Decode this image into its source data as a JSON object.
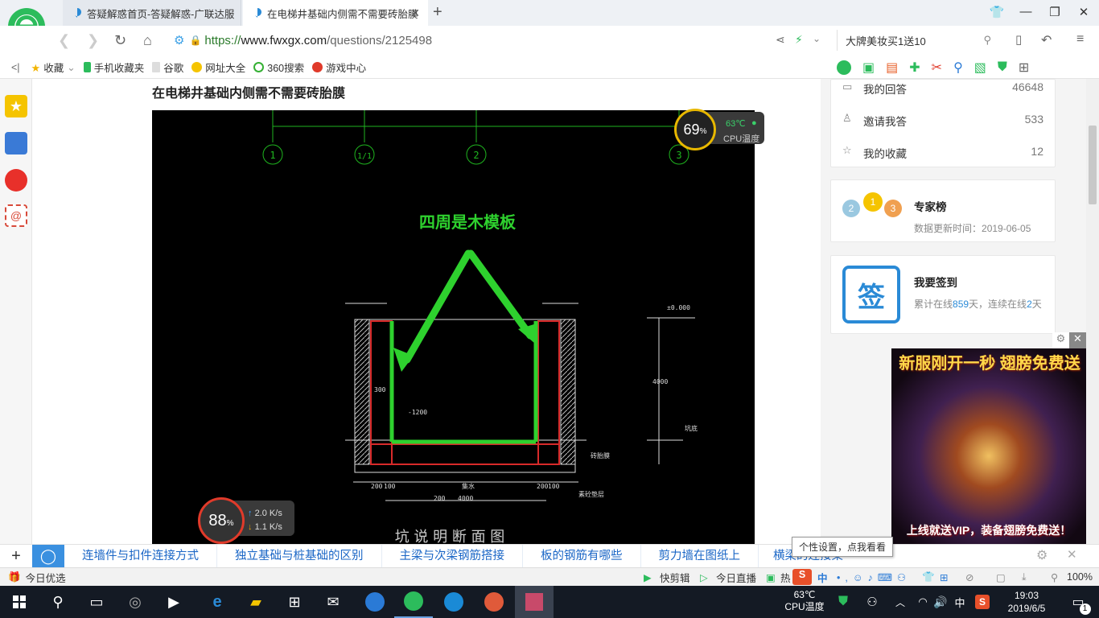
{
  "browser": {
    "tabs": [
      {
        "title": "答疑解惑首页-答疑解惑-广联达服"
      },
      {
        "title": "在电梯井基础内侧需不需要砖胎膜"
      }
    ],
    "url_https": "https://",
    "url_host": "www.fwxgx.com",
    "url_path": "/questions/2125498",
    "search_text": "大牌美妆买1送10"
  },
  "bookmarks": [
    "收藏",
    "手机收藏夹",
    "谷歌",
    "网址大全",
    "360搜索",
    "游戏中心"
  ],
  "page": {
    "title": "在电梯井基础内侧需不需要砖胎膜"
  },
  "cad": {
    "axes": [
      "1",
      "1/1",
      "2",
      "3"
    ],
    "annotation": "四周是木模板",
    "labels": [
      "300",
      "-1200",
      "±0.000",
      "砖胎膜",
      "素砼垫层",
      "4000",
      "200",
      "100",
      "集水",
      "200",
      "100",
      "200",
      "4000",
      "坑底"
    ],
    "bottom_text": "坑 说 明   断 面 图"
  },
  "cpu_widget": {
    "percent": "69",
    "unit": "%",
    "temp": "63℃",
    "label": "CPU温度"
  },
  "net_widget": {
    "percent": "88",
    "unit": "%",
    "up": "2.0",
    "down": "1.1",
    "rate_unit": "K/s"
  },
  "sidebar_right": {
    "stats": [
      {
        "label": "我的回答",
        "value": "46648"
      },
      {
        "label": "邀请我答",
        "value": "533"
      },
      {
        "label": "我的收藏",
        "value": "12"
      }
    ],
    "experts": {
      "title": "专家榜",
      "update_label": "数据更新时间：",
      "update_date": "2019-06-05",
      "medals": [
        "2",
        "1",
        "3"
      ]
    },
    "signin": {
      "title": "我要签到",
      "icon_text": "签",
      "prefix": "累计在线",
      "days1": "859",
      "mid": "天，连续在线",
      "days2": "2",
      "suffix": "天"
    }
  },
  "ad": {
    "top_text": "新服刚开一秒 翅膀免费送",
    "bottom_text": "上线就送VIP，装备翅膀免费送！"
  },
  "tooltip": "个性设置，点我看看",
  "related": [
    "连墙件与扣件连接方式",
    "独立基础与桩基础的区别",
    "主梁与次梁钢筋搭接",
    "板的钢筋有哪些",
    "剪力墙在图纸上",
    "横梁的连接梁"
  ],
  "statusbar": {
    "left": "今日优选",
    "items": [
      "快剪辑",
      "今日直播",
      "热"
    ],
    "ime": "中",
    "zoom": "100%"
  },
  "taskbar": {
    "cpu_temp": "63℃",
    "cpu_label": "CPU温度",
    "ime": "中",
    "time": "19:03",
    "date": "2019/6/5",
    "notif_count": "1"
  },
  "colors": {
    "accent_green": "#2ed12e",
    "link_blue": "#1a66c6",
    "taskbar": "#141a24"
  }
}
